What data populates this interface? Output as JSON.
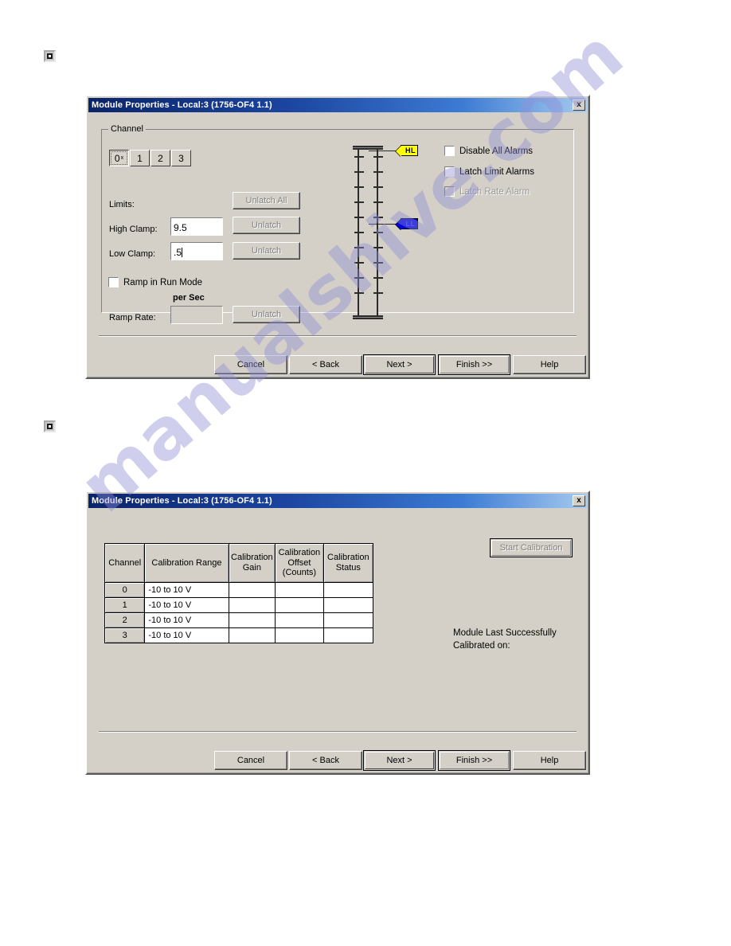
{
  "page": {
    "watermark": "manualshive.com"
  },
  "markers": [
    {
      "name": "page-marker-top"
    },
    {
      "name": "page-marker-bottom"
    }
  ],
  "dialog1": {
    "title": "Module Properties - Local:3 (1756-OF4 1.1)",
    "close_label": "x",
    "groupbox_label": "Channel",
    "channel_tabs": [
      {
        "label": "0",
        "sup": "x",
        "selected": true
      },
      {
        "label": "1",
        "sup": "",
        "selected": false
      },
      {
        "label": "2",
        "sup": "",
        "selected": false
      },
      {
        "label": "3",
        "sup": "",
        "selected": false
      }
    ],
    "limits_label": "Limits:",
    "unlatch_all_label": "Unlatch All",
    "high_clamp_label": "High Clamp:",
    "high_clamp_value": "9.5",
    "high_clamp_unlatch": "Unlatch",
    "low_clamp_label": "Low Clamp:",
    "low_clamp_value": ".5",
    "low_clamp_unlatch": "Unlatch",
    "ramp_in_run_mode_label": "Ramp in Run Mode",
    "per_sec_label": "per Sec",
    "ramp_rate_label": "Ramp Rate:",
    "ramp_rate_value": "",
    "ramp_rate_unlatch": "Unlatch",
    "gauge": {
      "high_flag": "HL",
      "low_flag": "LL",
      "high_flag_pos_pct": 6,
      "low_flag_pos_pct": 48,
      "tick_count": 11
    },
    "alarms": [
      {
        "label": "Disable All Alarms",
        "checked": false,
        "disabled": false
      },
      {
        "label": "Latch Limit Alarms",
        "checked": false,
        "disabled": false
      },
      {
        "label": "Latch Rate Alarm",
        "checked": false,
        "disabled": true
      }
    ],
    "buttons": [
      {
        "label": "Cancel",
        "style": "normal"
      },
      {
        "label": "< Back",
        "style": "normal"
      },
      {
        "label": "Next >",
        "style": "default"
      },
      {
        "label": "Finish >>",
        "style": "default2"
      },
      {
        "label": "Help",
        "style": "normal"
      }
    ]
  },
  "dialog2": {
    "title": "Module Properties - Local:3 (1756-OF4 1.1)",
    "close_label": "x",
    "table": {
      "headers": [
        "Channel",
        "Calibration Range",
        "Calibration\nGain",
        "Calibration\nOffset\n(Counts)",
        "Calibration\nStatus"
      ],
      "rows": [
        {
          "channel": "0",
          "range": "-10 to 10 V",
          "gain": "",
          "offset": "",
          "status": ""
        },
        {
          "channel": "1",
          "range": "-10 to 10 V",
          "gain": "",
          "offset": "",
          "status": ""
        },
        {
          "channel": "2",
          "range": "-10 to 10 V",
          "gain": "",
          "offset": "",
          "status": ""
        },
        {
          "channel": "3",
          "range": "-10 to 10 V",
          "gain": "",
          "offset": "",
          "status": ""
        }
      ]
    },
    "start_calibration_label": "Start Calibration",
    "last_calibrated_text": "Module Last Successfully\nCalibrated on:",
    "buttons": [
      {
        "label": "Cancel",
        "style": "normal"
      },
      {
        "label": "< Back",
        "style": "normal"
      },
      {
        "label": "Next >",
        "style": "default"
      },
      {
        "label": "Finish >>",
        "style": "default2"
      },
      {
        "label": "Help",
        "style": "normal"
      }
    ]
  }
}
